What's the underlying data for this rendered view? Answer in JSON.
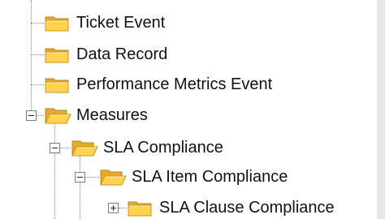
{
  "tree": {
    "items": [
      {
        "label": "Ticket Event",
        "icon": "folder-closed-icon",
        "expander": "none"
      },
      {
        "label": "Data Record",
        "icon": "folder-closed-icon",
        "expander": "none"
      },
      {
        "label": "Performance Metrics Event",
        "icon": "folder-closed-icon",
        "expander": "none"
      },
      {
        "label": "Measures",
        "icon": "folder-open-icon",
        "expander": "collapse"
      },
      {
        "label": "SLA Compliance",
        "icon": "folder-open-icon",
        "expander": "collapse"
      },
      {
        "label": "SLA Item Compliance",
        "icon": "folder-open-icon",
        "expander": "collapse"
      },
      {
        "label": "SLA Clause Compliance",
        "icon": "folder-closed-icon",
        "expander": "expand"
      }
    ]
  },
  "colors": {
    "folder_fill": "#ffd34f",
    "folder_shade": "#e6a92a",
    "tree_lines": "#8a8a8a",
    "text": "#111111"
  }
}
